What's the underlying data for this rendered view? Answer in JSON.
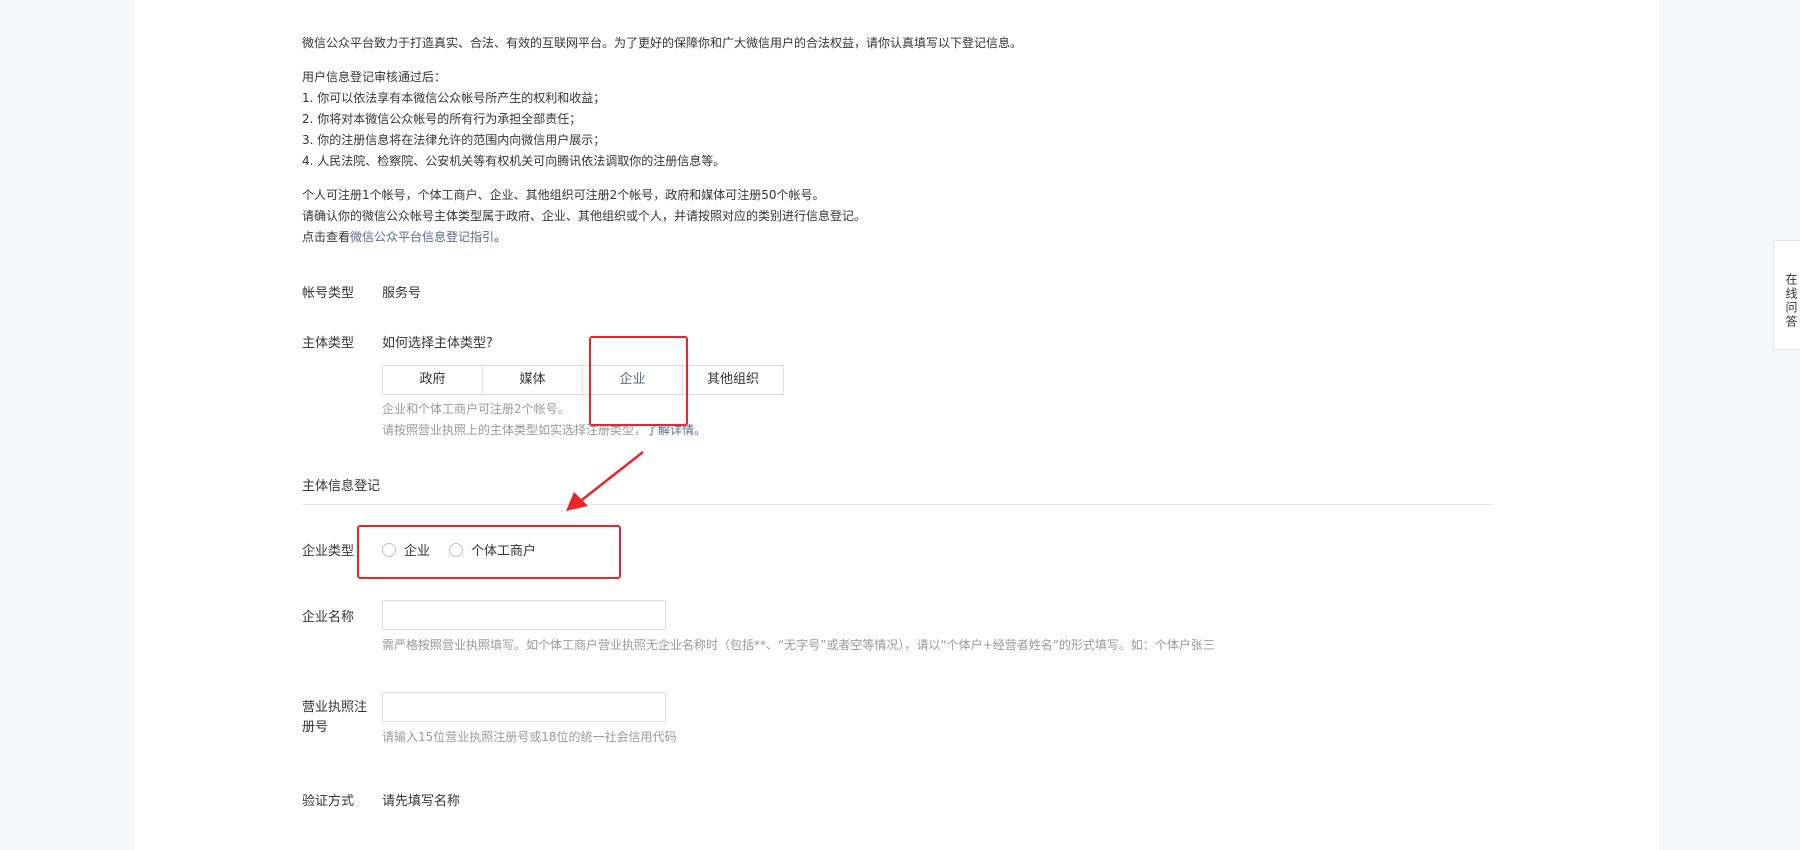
{
  "intro": {
    "line1": "微信公众平台致力于打造真实、合法、有效的互联网平台。为了更好的保障你和广大微信用户的合法权益，请你认真填写以下登记信息。",
    "audit_title": "用户信息登记审核通过后：",
    "audit_items": [
      "1. 你可以依法享有本微信公众帐号所产生的权利和收益；",
      "2. 你将对本微信公众帐号的所有行为承担全部责任；",
      "3. 你的注册信息将在法律允许的范围内向微信用户展示；",
      "4. 人民法院、检察院、公安机关等有权机关可向腾讯依法调取你的注册信息等。"
    ],
    "limit_text": "个人可注册1个帐号，个体工商户、企业、其他组织可注册2个帐号，政府和媒体可注册50个帐号。",
    "confirm_text": "请确认你的微信公众帐号主体类型属于政府、企业、其他组织或个人，并请按照对应的类别进行信息登记。",
    "guide_prefix": "点击查看",
    "guide_link": "微信公众平台信息登记指引",
    "guide_suffix": "。"
  },
  "account_type": {
    "label": "帐号类型",
    "value": "服务号"
  },
  "subject_type": {
    "label": "主体类型",
    "help_link": "如何选择主体类型?",
    "options": [
      "政府",
      "媒体",
      "企业",
      "其他组织"
    ],
    "selected": "企业",
    "hint1": "企业和个体工商户可注册2个帐号。",
    "hint2_prefix": "请按照营业执照上的主体类型如实选择注册类型，",
    "hint2_link": "了解详情。"
  },
  "section": {
    "title": "主体信息登记"
  },
  "enterprise_type": {
    "label": "企业类型",
    "options": [
      "企业",
      "个体工商户"
    ]
  },
  "enterprise_name": {
    "label": "企业名称",
    "value": "",
    "hint": "需严格按照营业执照填写。如个体工商户营业执照无企业名称时（包括**、“无字号”或者空等情况），请以“个体户+经营者姓名”的形式填写。如：个体户张三"
  },
  "license_no": {
    "label_line1": "营业执照注",
    "label_line2": "册号",
    "value": "",
    "hint": "请输入15位营业执照注册号或18位的统一社会信用代码"
  },
  "verify": {
    "label": "验证方式",
    "value": "请先填写名称"
  },
  "side_tab": {
    "label": "在线问答"
  },
  "colors": {
    "annotation_red": "#e8262a",
    "link_blue": "#576b95"
  }
}
